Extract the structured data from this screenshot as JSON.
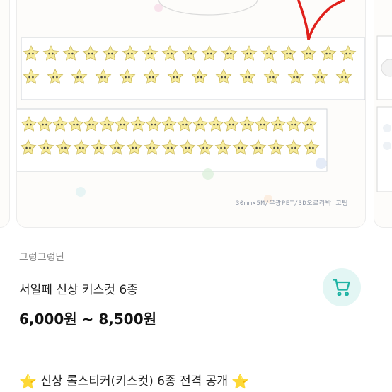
{
  "product_image": {
    "spec_text": "30mm×5M/무광PET/3D오로라박 코팅"
  },
  "seller": {
    "name": "그렁그렁단"
  },
  "product": {
    "title": "서일페 신상 키스컷 6종",
    "price": "6,000원 ~ 8,500원"
  },
  "actions": {
    "cart_icon": "cart-icon"
  },
  "description": {
    "star_left": "⭐",
    "text": "신상 롤스티커(키스컷) 6종 전격 공개",
    "star_right": "⭐"
  },
  "colors": {
    "accent": "#1fb3a4",
    "cart_bg": "#e3f6f4",
    "annotation": "#e0201b",
    "sticker_yellow": "#f7ec9c",
    "sticker_outline": "#c8b65a"
  }
}
